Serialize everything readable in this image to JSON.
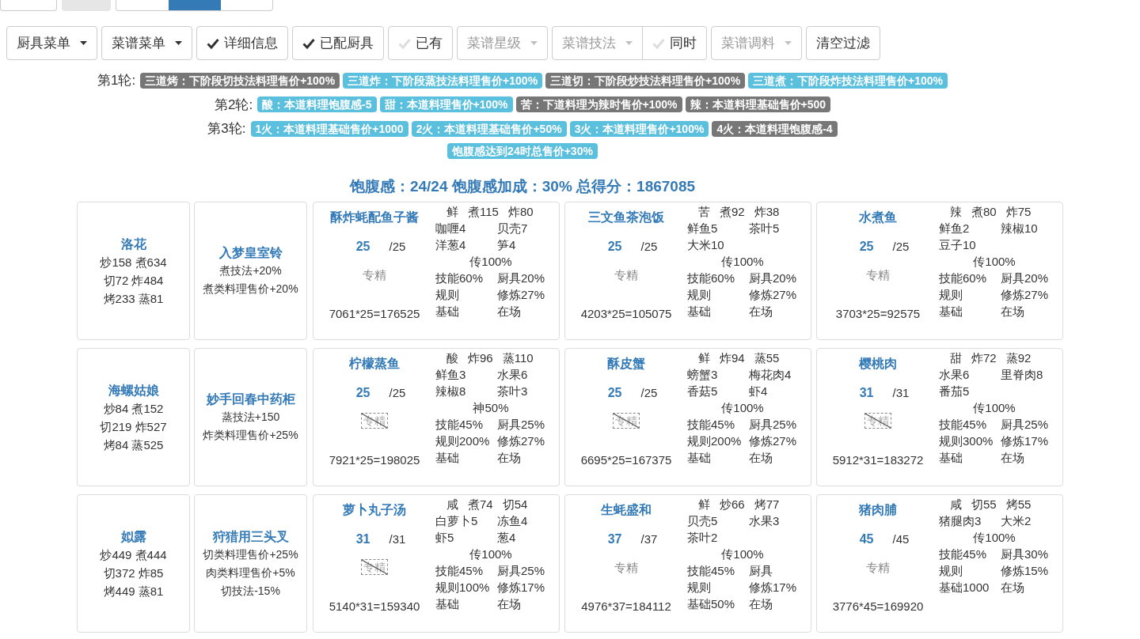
{
  "top_buttons": [
    {
      "kind": "plain"
    },
    {
      "kind": "gray"
    },
    {
      "kind": "group"
    }
  ],
  "filters": [
    {
      "kind": "dropdown",
      "label": "厨具菜单",
      "disabled": false
    },
    {
      "kind": "dropdown",
      "label": "菜谱菜单",
      "disabled": false
    },
    {
      "kind": "check",
      "label": "详细信息",
      "checked": true
    },
    {
      "kind": "check",
      "label": "已配厨具",
      "checked": true
    },
    {
      "kind": "check",
      "label": "已有",
      "checked": false
    },
    {
      "kind": "dropdown",
      "label": "菜谱星级",
      "disabled": true
    },
    {
      "kind": "group",
      "items": [
        {
          "kind": "dropdown",
          "label": "菜谱技法",
          "disabled": true
        },
        {
          "kind": "check",
          "label": "同时",
          "checked": false
        }
      ]
    },
    {
      "kind": "dropdown",
      "label": "菜谱调料",
      "disabled": true
    },
    {
      "kind": "plain",
      "label": "清空过滤"
    }
  ],
  "rounds": [
    {
      "label": "第1轮:",
      "tags": [
        {
          "text": "三道烤：下阶段切技法料理售价+100%",
          "color": "#777777"
        },
        {
          "text": "三道炸：下阶段蒸技法料理售价+100%",
          "color": "#5bc0de"
        },
        {
          "text": "三道切：下阶段炒技法料理售价+100%",
          "color": "#777777"
        },
        {
          "text": "三道煮：下阶段炸技法料理售价+100%",
          "color": "#5bc0de"
        }
      ]
    },
    {
      "label": "第2轮:",
      "tags": [
        {
          "text": "酸：本道料理饱腹感-5",
          "color": "#5bc0de"
        },
        {
          "text": "甜：本道料理售价+100%",
          "color": "#5bc0de"
        },
        {
          "text": "苦：下道料理为辣时售价+100%",
          "color": "#777777"
        },
        {
          "text": "辣：本道料理基础售价+500",
          "color": "#777777"
        }
      ]
    },
    {
      "label": "第3轮:",
      "tags": [
        {
          "text": "1火：本道料理基础售价+1000",
          "color": "#5bc0de"
        },
        {
          "text": "2火：本道料理基础售价+50%",
          "color": "#5bc0de"
        },
        {
          "text": "3火：本道料理售价+100%",
          "color": "#5bc0de"
        },
        {
          "text": "4火：本道料理饱腹感-4",
          "color": "#777777"
        }
      ]
    },
    {
      "tags": [
        {
          "text": "饱腹感达到24时总售价+30%",
          "color": "#5bc0de"
        }
      ]
    }
  ],
  "summary": "饱腹感：24/24 饱腹感加成：30% 总得分：1867085",
  "rows": [
    {
      "chef": {
        "name": "洛花",
        "skills": [
          "炒158 煮634",
          "切72 炸484",
          "烤233 蒸81"
        ]
      },
      "equipment": {
        "name": "入梦皇室铃",
        "effects": [
          "煮技法+20%",
          "煮类料理售价+20%"
        ]
      },
      "recipes": [
        {
          "name": "酥炸蚝配鱼子酱",
          "count": "25",
          "max": "/25",
          "specialty": {
            "label": "专精",
            "crossed": false
          },
          "formula": "7061*25=176525",
          "header": [
            "鲜",
            "煮115",
            "炸80"
          ],
          "ingredients": [
            "咖喱4",
            "贝壳7",
            "洋葱4",
            "笋4"
          ],
          "bonus": "传100%",
          "stats": [
            "技能60%",
            "厨具20%",
            "规则",
            "修炼27%",
            "基础",
            "在场"
          ]
        },
        {
          "name": "三文鱼茶泡饭",
          "count": "25",
          "max": "/25",
          "specialty": {
            "label": "专精",
            "crossed": false
          },
          "formula": "4203*25=105075",
          "header": [
            "苦",
            "煮92",
            "炸38"
          ],
          "ingredients": [
            "鲜鱼5",
            "茶叶5",
            "大米10"
          ],
          "bonus": "传100%",
          "stats": [
            "技能60%",
            "厨具20%",
            "规则",
            "修炼27%",
            "基础",
            "在场"
          ]
        },
        {
          "name": "水煮鱼",
          "count": "25",
          "max": "/25",
          "specialty": {
            "label": "专精",
            "crossed": false
          },
          "formula": "3703*25=92575",
          "header": [
            "辣",
            "煮80",
            "炸75"
          ],
          "ingredients": [
            "鲜鱼2",
            "辣椒10",
            "豆子10"
          ],
          "bonus": "传100%",
          "stats": [
            "技能60%",
            "厨具20%",
            "规则",
            "修炼27%",
            "基础",
            "在场"
          ]
        }
      ]
    },
    {
      "chef": {
        "name": "海螺姑娘",
        "skills": [
          "炒84 煮152",
          "切219 炸527",
          "烤84 蒸525"
        ]
      },
      "equipment": {
        "name": "妙手回春中药柜",
        "effects": [
          "蒸技法+150",
          "炸类料理售价+25%"
        ]
      },
      "recipes": [
        {
          "name": "柠檬蒸鱼",
          "count": "25",
          "max": "/25",
          "specialty": {
            "label": "专精",
            "crossed": true
          },
          "formula": "7921*25=198025",
          "header": [
            "酸",
            "炸96",
            "蒸110"
          ],
          "ingredients": [
            "鲜鱼3",
            "水果6",
            "辣椒8",
            "茶叶3"
          ],
          "bonus": "神50%",
          "stats": [
            "技能45%",
            "厨具25%",
            "规则200%",
            "修炼27%",
            "基础",
            "在场"
          ]
        },
        {
          "name": "酥皮蟹",
          "count": "25",
          "max": "/25",
          "specialty": {
            "label": "专精",
            "crossed": true
          },
          "formula": "6695*25=167375",
          "header": [
            "鲜",
            "炸94",
            "蒸55"
          ],
          "ingredients": [
            "螃蟹3",
            "梅花肉4",
            "香菇5",
            "虾4"
          ],
          "bonus": "传100%",
          "stats": [
            "技能45%",
            "厨具25%",
            "规则200%",
            "修炼27%",
            "基础",
            "在场"
          ]
        },
        {
          "name": "樱桃肉",
          "count": "31",
          "max": "/31",
          "specialty": {
            "label": "专精",
            "crossed": true
          },
          "formula": "5912*31=183272",
          "header": [
            "甜",
            "炸72",
            "蒸92"
          ],
          "ingredients": [
            "水果6",
            "里脊肉8",
            "番茄5"
          ],
          "bonus": "传100%",
          "stats": [
            "技能45%",
            "厨具25%",
            "规则300%",
            "修炼17%",
            "基础",
            "在场"
          ]
        }
      ]
    },
    {
      "chef": {
        "name": "姒露",
        "skills": [
          "炒449 煮444",
          "切372 炸85",
          "烤449 蒸81"
        ]
      },
      "equipment": {
        "name": "狩猎用三头叉",
        "effects": [
          "切类料理售价+25%",
          "肉类料理售价+5%",
          "切技法-15%"
        ]
      },
      "recipes": [
        {
          "name": "萝卜丸子汤",
          "count": "31",
          "max": "/31",
          "specialty": {
            "label": "专精",
            "crossed": true
          },
          "formula": "5140*31=159340",
          "header": [
            "咸",
            "煮74",
            "切54"
          ],
          "ingredients": [
            "白萝卜5",
            "冻鱼4",
            "虾5",
            "葱4"
          ],
          "bonus": "传100%",
          "stats": [
            "技能45%",
            "厨具25%",
            "规则100%",
            "修炼17%",
            "基础",
            "在场"
          ]
        },
        {
          "name": "生蚝盛和",
          "count": "37",
          "max": "/37",
          "specialty": {
            "label": "专精",
            "crossed": false
          },
          "formula": "4976*37=184112",
          "header": [
            "鲜",
            "炒66",
            "烤77"
          ],
          "ingredients": [
            "贝壳5",
            "水果3",
            "茶叶2"
          ],
          "bonus": "传100%",
          "stats": [
            "技能45%",
            "厨具",
            "规则",
            "修炼17%",
            "基础50%",
            "在场"
          ]
        },
        {
          "name": "猪肉脯",
          "count": "45",
          "max": "/45",
          "specialty": {
            "label": "专精",
            "crossed": false
          },
          "formula": "3776*45=169920",
          "header": [
            "咸",
            "切55",
            "烤55"
          ],
          "ingredients": [
            "猪腿肉3",
            "大米2"
          ],
          "bonus": "传100%",
          "stats": [
            "技能45%",
            "厨具30%",
            "规则",
            "修炼15%",
            "基础1000",
            "在场"
          ]
        }
      ]
    }
  ]
}
